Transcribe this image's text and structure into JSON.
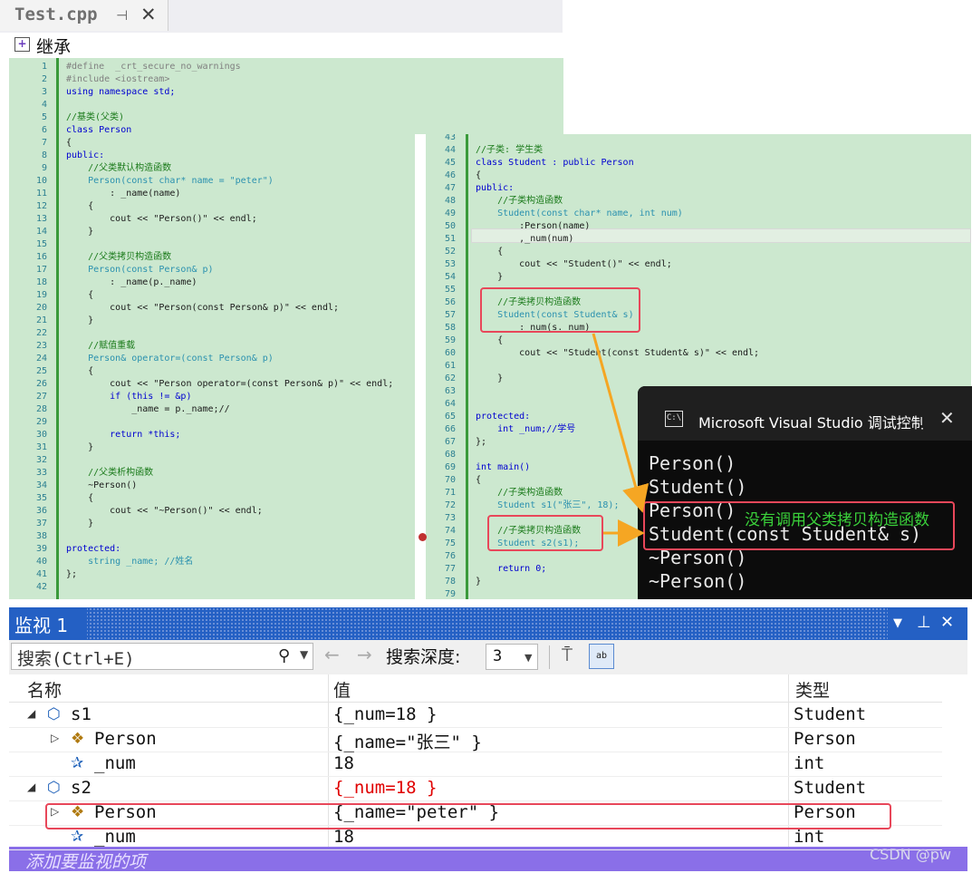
{
  "editor": {
    "tab_title": "Test.cpp",
    "tab_pin": "⊣",
    "tab_close": "✕",
    "scope_label": "继承"
  },
  "code_left": [
    {
      "n": "1",
      "t": "#define  _crt_secure_no_warnings",
      "c": "pp"
    },
    {
      "n": "2",
      "t": "#include <iostream>",
      "c": "pp"
    },
    {
      "n": "3",
      "t": "using namespace std;",
      "c": "kw"
    },
    {
      "n": "4",
      "t": "",
      "c": ""
    },
    {
      "n": "5",
      "t": "//基类(父类)",
      "c": "cmt"
    },
    {
      "n": "6",
      "t": "class Person",
      "c": "kw"
    },
    {
      "n": "7",
      "t": "{",
      "c": ""
    },
    {
      "n": "8",
      "t": "public:",
      "c": "kw"
    },
    {
      "n": "9",
      "t": "    //父类默认构造函数",
      "c": "cmt"
    },
    {
      "n": "10",
      "t": "    Person(const char* name = \"peter\")",
      "c": "ty"
    },
    {
      "n": "11",
      "t": "        : _name(name)",
      "c": ""
    },
    {
      "n": "12",
      "t": "    {",
      "c": ""
    },
    {
      "n": "13",
      "t": "        cout << \"Person()\" << endl;",
      "c": ""
    },
    {
      "n": "14",
      "t": "    }",
      "c": ""
    },
    {
      "n": "15",
      "t": "",
      "c": ""
    },
    {
      "n": "16",
      "t": "    //父类拷贝构造函数",
      "c": "cmt"
    },
    {
      "n": "17",
      "t": "    Person(const Person& p)",
      "c": "ty"
    },
    {
      "n": "18",
      "t": "        : _name(p._name)",
      "c": ""
    },
    {
      "n": "19",
      "t": "    {",
      "c": ""
    },
    {
      "n": "20",
      "t": "        cout << \"Person(const Person& p)\" << endl;",
      "c": ""
    },
    {
      "n": "21",
      "t": "    }",
      "c": ""
    },
    {
      "n": "22",
      "t": "",
      "c": ""
    },
    {
      "n": "23",
      "t": "    //赋值重载",
      "c": "cmt"
    },
    {
      "n": "24",
      "t": "    Person& operator=(const Person& p)",
      "c": "ty"
    },
    {
      "n": "25",
      "t": "    {",
      "c": ""
    },
    {
      "n": "26",
      "t": "        cout << \"Person operator=(const Person& p)\" << endl;",
      "c": ""
    },
    {
      "n": "27",
      "t": "        if (this != &p)",
      "c": "kw"
    },
    {
      "n": "28",
      "t": "            _name = p._name;//",
      "c": ""
    },
    {
      "n": "29",
      "t": "",
      "c": ""
    },
    {
      "n": "30",
      "t": "        return *this;",
      "c": "kw"
    },
    {
      "n": "31",
      "t": "    }",
      "c": ""
    },
    {
      "n": "32",
      "t": "",
      "c": ""
    },
    {
      "n": "33",
      "t": "    //父类析构函数",
      "c": "cmt"
    },
    {
      "n": "34",
      "t": "    ~Person()",
      "c": ""
    },
    {
      "n": "35",
      "t": "    {",
      "c": ""
    },
    {
      "n": "36",
      "t": "        cout << \"~Person()\" << endl;",
      "c": ""
    },
    {
      "n": "37",
      "t": "    }",
      "c": ""
    },
    {
      "n": "38",
      "t": "",
      "c": ""
    },
    {
      "n": "39",
      "t": "protected:",
      "c": "kw"
    },
    {
      "n": "40",
      "t": "    string _name; //姓名",
      "c": "ty"
    },
    {
      "n": "41",
      "t": "};",
      "c": ""
    },
    {
      "n": "42",
      "t": "",
      "c": ""
    }
  ],
  "code_right": [
    {
      "n": "43",
      "t": "",
      "c": ""
    },
    {
      "n": "44",
      "t": "//子类: 学生类",
      "c": "cmt"
    },
    {
      "n": "45",
      "t": "class Student : public Person",
      "c": "kw"
    },
    {
      "n": "46",
      "t": "{",
      "c": ""
    },
    {
      "n": "47",
      "t": "public:",
      "c": "kw"
    },
    {
      "n": "48",
      "t": "    //子类构造函数",
      "c": "cmt"
    },
    {
      "n": "49",
      "t": "    Student(const char* name, int num)",
      "c": "ty"
    },
    {
      "n": "50",
      "t": "        :Person(name)",
      "c": ""
    },
    {
      "n": "51",
      "t": "        ,_num(num)",
      "c": ""
    },
    {
      "n": "52",
      "t": "    {",
      "c": ""
    },
    {
      "n": "53",
      "t": "        cout << \"Student()\" << endl;",
      "c": ""
    },
    {
      "n": "54",
      "t": "    }",
      "c": ""
    },
    {
      "n": "55",
      "t": "",
      "c": ""
    },
    {
      "n": "56",
      "t": "    //子类拷贝构造函数",
      "c": "cmt"
    },
    {
      "n": "57",
      "t": "    Student(const Student& s)",
      "c": "ty"
    },
    {
      "n": "58",
      "t": "        :_num(s._num)",
      "c": ""
    },
    {
      "n": "59",
      "t": "    {",
      "c": ""
    },
    {
      "n": "60",
      "t": "        cout << \"Student(const Student& s)\" << endl;",
      "c": ""
    },
    {
      "n": "61",
      "t": "",
      "c": ""
    },
    {
      "n": "62",
      "t": "    }",
      "c": ""
    },
    {
      "n": "63",
      "t": "",
      "c": ""
    },
    {
      "n": "64",
      "t": "",
      "c": ""
    },
    {
      "n": "65",
      "t": "protected:",
      "c": "kw"
    },
    {
      "n": "66",
      "t": "    int _num;//学号",
      "c": "kw"
    },
    {
      "n": "67",
      "t": "};",
      "c": ""
    },
    {
      "n": "68",
      "t": "",
      "c": ""
    },
    {
      "n": "69",
      "t": "int main()",
      "c": "kw"
    },
    {
      "n": "70",
      "t": "{",
      "c": ""
    },
    {
      "n": "71",
      "t": "    //子类构造函数",
      "c": "cmt"
    },
    {
      "n": "72",
      "t": "    Student s1(\"张三\", 18);",
      "c": "ty"
    },
    {
      "n": "73",
      "t": "",
      "c": ""
    },
    {
      "n": "74",
      "t": "    //子类拷贝构造函数",
      "c": "cmt"
    },
    {
      "n": "75",
      "t": "    Student s2(s1);",
      "c": "ty"
    },
    {
      "n": "76",
      "t": "",
      "c": ""
    },
    {
      "n": "77",
      "t": "    return 0;",
      "c": "kw"
    },
    {
      "n": "78",
      "t": "}",
      "c": ""
    },
    {
      "n": "79",
      "t": "",
      "c": ""
    }
  ],
  "console": {
    "title": "Microsoft Visual Studio 调试控制台",
    "icon": "C:\\",
    "close": "✕",
    "lines": [
      "Person()",
      "Student()",
      "Person()",
      "Student(const Student& s)",
      "~Person()",
      "~Person()"
    ]
  },
  "annotation": "没有调用父类拷贝构造函数",
  "watch": {
    "title": "监视 1",
    "ctrl_dropdown": "▼",
    "ctrl_pin": "⊥",
    "ctrl_close": "✕",
    "search_placeholder": "搜索(Ctrl+E)",
    "search_icon": "⚲",
    "depth_label": "搜索深度:",
    "depth_value": "3",
    "hex_label": "ab",
    "columns": {
      "name": "名称",
      "value": "值",
      "type": "类型"
    },
    "rows": [
      {
        "indent": 0,
        "expander": "◢",
        "icon": "object-icon",
        "name": "s1",
        "value": "{_num=18 }",
        "type": "Student",
        "changed": false
      },
      {
        "indent": 1,
        "expander": "▷",
        "icon": "base-class-icon",
        "name": "Person",
        "value": "{_name=\"张三\" }",
        "type": "Person",
        "changed": false
      },
      {
        "indent": 1,
        "expander": "",
        "icon": "field-icon",
        "name": "_num",
        "value": "18",
        "type": "int",
        "changed": false
      },
      {
        "indent": 0,
        "expander": "◢",
        "icon": "object-icon",
        "name": "s2",
        "value": "{_num=18 }",
        "type": "Student",
        "changed": true
      },
      {
        "indent": 1,
        "expander": "▷",
        "icon": "base-class-icon",
        "name": "Person",
        "value": "{_name=\"peter\" }",
        "type": "Person",
        "changed": false
      },
      {
        "indent": 1,
        "expander": "",
        "icon": "field-icon",
        "name": "_num",
        "value": "18",
        "type": "int",
        "changed": false
      }
    ],
    "add_item": "添加要监视的项"
  },
  "watermark": "CSDN @pw",
  "colors": {
    "code_bg": "#cce8cf",
    "accent_blue": "#2460c4",
    "highlight_red": "#e8475a",
    "arrow_orange": "#f5a623",
    "annotation_green": "#3ad13a",
    "changed_red": "#e00000",
    "add_row": "#8a6fe8"
  }
}
